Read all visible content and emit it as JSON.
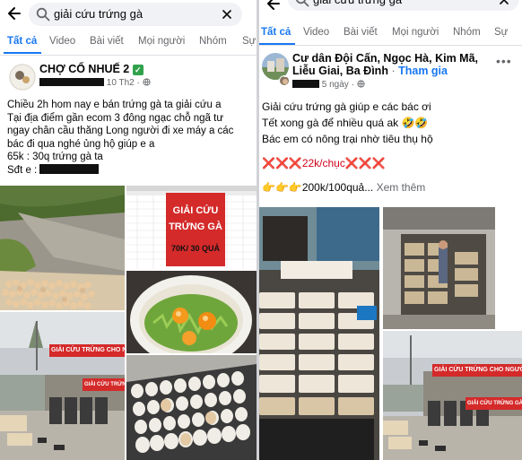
{
  "search": {
    "query": "giải cứu trứng gà"
  },
  "tabs": [
    "Tất cả",
    "Video",
    "Bài viết",
    "Mọi người",
    "Nhóm",
    "Sự"
  ],
  "post_left": {
    "group_name": "CHỢ CỔ NHUẾ 2",
    "meta_suffix": "10 Th2 ·",
    "lines": [
      "Chiều 2h hom nay e bán trứng gà ta  giải cứu a",
      "Tại địa điểm gần  ecom 3  đông ngạc chỗ ngã tư",
      "ngay chân cầu thăng Long người đi xe máy a  các",
      "bác đi qua nghé ủng hộ giúp e a",
      " 65k : 30q trứng gà ta",
      "Sđt e :"
    ],
    "sign_text": [
      "GIẢI CỨU",
      "TRỨNG GÀ",
      "70K/ 30 QUẢ"
    ]
  },
  "post_right": {
    "group_name_line1": "Cư dân Đội Cấn, Ngọc Hà, Kim Mã,",
    "group_name_line2": "Liễu Giai, Ba Đình",
    "join_label": "Tham gia",
    "meta_suffix": "5 ngày ·",
    "lines": [
      "Giải cứu trứng gà giúp e các bác ơi",
      "Tết xong gà để nhiều quá ak 🤣🤣",
      "Bác em  có nông trại nhờ tiêu thụ hộ",
      "",
      "❌❌❌22k/chục❌❌❌",
      "",
      "👉👉👉200k/100quả..."
    ],
    "see_more": "Xem thêm"
  },
  "banner_text": "GIẢI CỨU TRỨNG CHO NGƯỜI CHĂN",
  "banner_text_short": "GIẢI CỨU TRỨNG GÀ NGƯỜI",
  "colors": {
    "accent": "#1877f2",
    "banner_red": "#d42a2a",
    "verified_green": "#31a24c"
  }
}
